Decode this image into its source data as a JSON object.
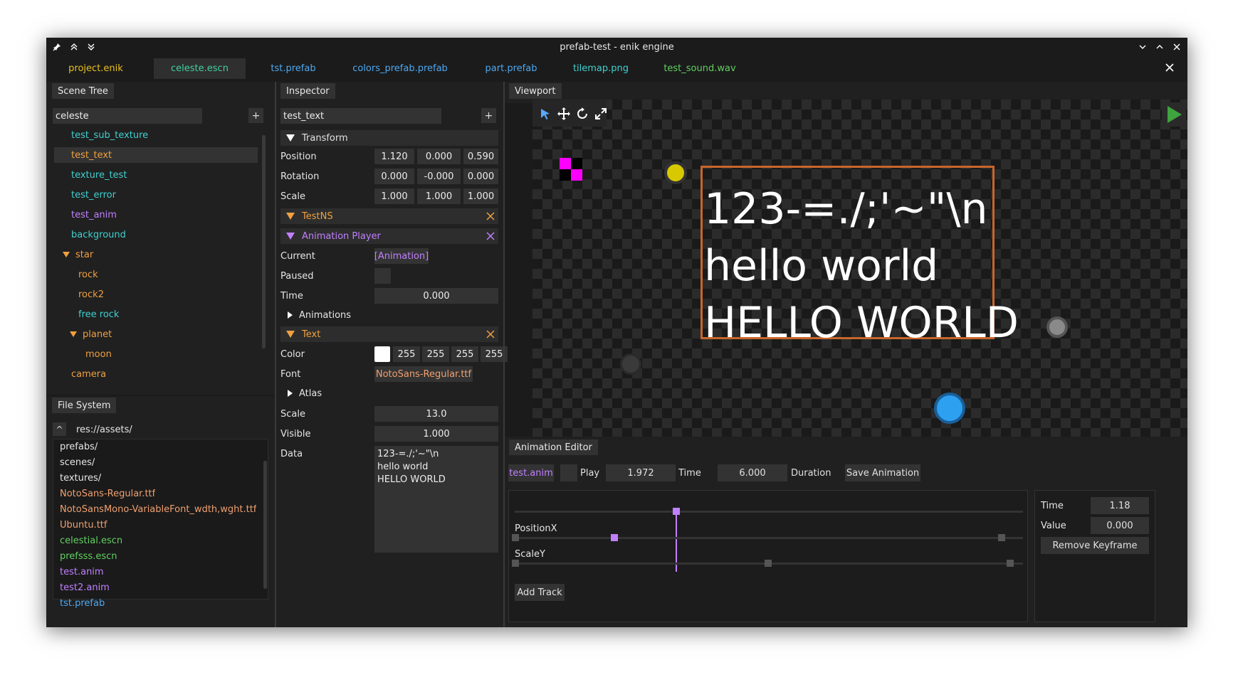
{
  "window": {
    "title": "prefab-test - enik engine"
  },
  "file_tabs": [
    {
      "label": "project.enik",
      "color": "#e8c020",
      "active": false
    },
    {
      "label": "celeste.escn",
      "color": "#40d0a0",
      "active": true
    },
    {
      "label": "tst.prefab",
      "color": "#4ea8f0",
      "active": false
    },
    {
      "label": "colors_prefab.prefab",
      "color": "#4ea8f0",
      "active": false
    },
    {
      "label": "part.prefab",
      "color": "#4ea8f0",
      "active": false
    },
    {
      "label": "tilemap.png",
      "color": "#40d0d0",
      "active": false
    },
    {
      "label": "test_sound.wav",
      "color": "#60d060",
      "active": false
    }
  ],
  "scene_tree": {
    "tab": "Scene Tree",
    "search_value": "celeste",
    "add_label": "+",
    "items": [
      {
        "label": "test_sub_texture",
        "color": "#40d0d0"
      },
      {
        "label": "test_text",
        "color": "#f0a040",
        "selected": true
      },
      {
        "label": "texture_test",
        "color": "#40d0d0"
      },
      {
        "label": "test_error",
        "color": "#40d0d0"
      },
      {
        "label": "test_anim",
        "color": "#c080ff"
      },
      {
        "label": "background",
        "color": "#40d0d0"
      },
      {
        "label": "star",
        "color": "#f0a040",
        "expanded": true
      },
      {
        "label": "rock",
        "color": "#f0a040"
      },
      {
        "label": "rock2",
        "color": "#f0a040"
      },
      {
        "label": "free rock",
        "color": "#40d0d0"
      },
      {
        "label": "planet",
        "color": "#f0a040",
        "expanded": true
      },
      {
        "label": "moon",
        "color": "#f0a040"
      },
      {
        "label": "camera",
        "color": "#f0a040"
      }
    ]
  },
  "file_system": {
    "tab": "File System",
    "up_label": "^",
    "path": "res://assets/",
    "items": [
      {
        "label": "prefabs/",
        "color": "#e6e6e6"
      },
      {
        "label": "scenes/",
        "color": "#e6e6e6"
      },
      {
        "label": "textures/",
        "color": "#e6e6e6"
      },
      {
        "label": "NotoSans-Regular.ttf",
        "color": "#f0a070"
      },
      {
        "label": "NotoSansMono-VariableFont_wdth,wght.ttf",
        "color": "#f0a070"
      },
      {
        "label": "Ubuntu.ttf",
        "color": "#f0a070"
      },
      {
        "label": "celestial.escn",
        "color": "#60d060"
      },
      {
        "label": "prefsss.escn",
        "color": "#60d060"
      },
      {
        "label": "test.anim",
        "color": "#c080ff"
      },
      {
        "label": "test2.anim",
        "color": "#c080ff"
      },
      {
        "label": "tst.prefab",
        "color": "#4ea8f0"
      }
    ]
  },
  "inspector": {
    "tab": "Inspector",
    "name_value": "test_text",
    "add_label": "+",
    "transform": {
      "header": "Transform",
      "position_label": "Position",
      "position": [
        "1.120",
        "0.000",
        "0.590"
      ],
      "rotation_label": "Rotation",
      "rotation": [
        "0.000",
        "-0.000",
        "0.000"
      ],
      "scale_label": "Scale",
      "scale": [
        "1.000",
        "1.000",
        "1.000"
      ]
    },
    "testns": {
      "header": "TestNS",
      "color": "#f0a040"
    },
    "animation_player": {
      "header": "Animation Player",
      "color": "#c080ff",
      "current_label": "Current",
      "current_value": "[Animation]",
      "paused_label": "Paused",
      "time_label": "Time",
      "time_value": "0.000",
      "animations_label": "Animations"
    },
    "text": {
      "header": "Text",
      "color": "#f0a040",
      "color_label": "Color",
      "rgba": [
        "255",
        "255",
        "255",
        "255"
      ],
      "font_label": "Font",
      "font_value": "NotoSans-Regular.ttf",
      "atlas_label": "Atlas",
      "scale_label": "Scale",
      "scale_value": "13.0",
      "visible_label": "Visible",
      "visible_value": "1.000",
      "data_label": "Data",
      "data_lines": [
        "123-=./;'~\"\\n",
        "hello world",
        "HELLO WORLD"
      ]
    }
  },
  "viewport": {
    "tab": "Viewport",
    "tools": [
      "select-icon",
      "move-icon",
      "rotate-icon",
      "scale-icon"
    ],
    "play_icon": "play-icon",
    "text_lines": [
      "123-=./;'~\"\\n",
      "hello world",
      "HELLO WORLD"
    ],
    "frame_color": "#c8662a"
  },
  "animation_editor": {
    "tab": "Animation Editor",
    "anim_name": "test.anim",
    "play_label": "Play",
    "time_value": "1.972",
    "time_label": "Time",
    "duration_value": "6.000",
    "duration_label": "Duration",
    "save_label": "Save Animation",
    "tracks": [
      {
        "name": "PositionX"
      },
      {
        "name": "ScaleY"
      }
    ],
    "add_track_label": "Add Track",
    "keyframe": {
      "time_label": "Time",
      "time_value": "1.18",
      "value_label": "Value",
      "value_value": "0.000",
      "remove_label": "Remove Keyframe"
    }
  }
}
